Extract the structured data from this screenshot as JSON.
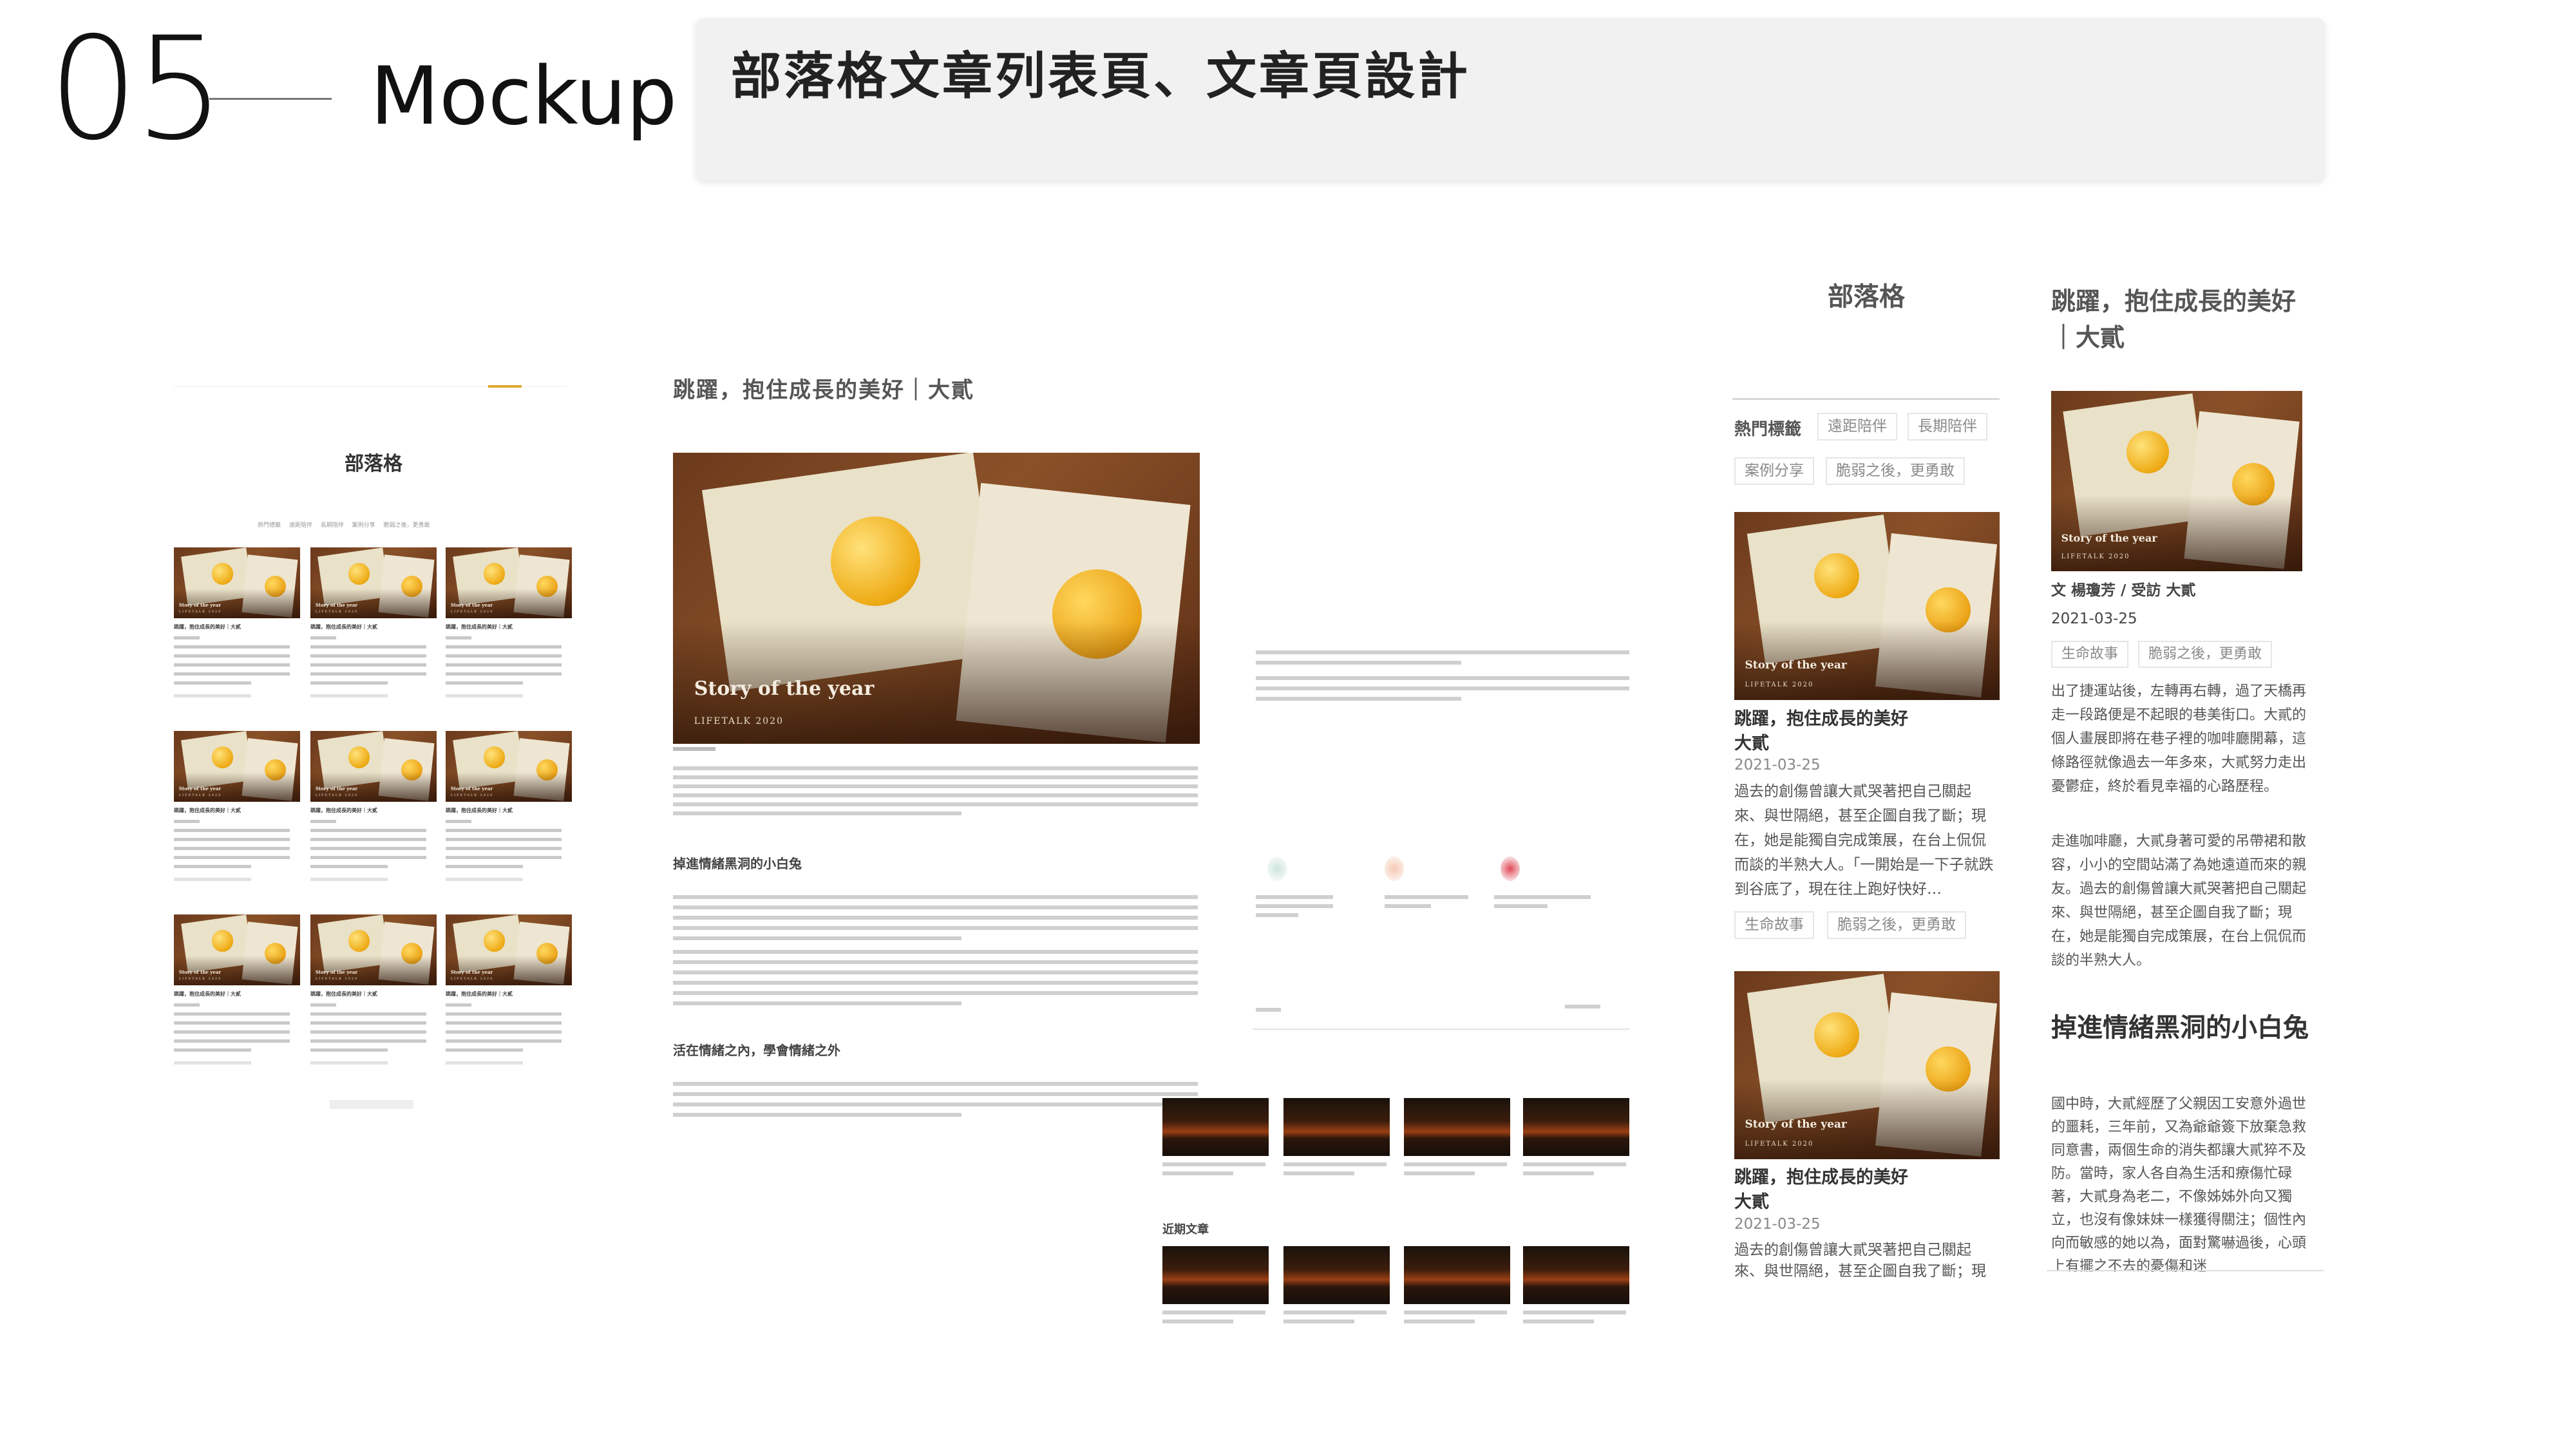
{
  "header": {
    "section_number": "05",
    "section_title": "Mockup",
    "caption": "部落格文章列表頁、文章頁設計"
  },
  "list_page": {
    "title": "部落格",
    "tags_row": "熱門標籤 遠距陪伴 長期陪伴 案例分享 脆弱之後，更勇敢",
    "card_title": "跳躍，抱住成長的美好｜大貳"
  },
  "article_page": {
    "title": "跳躍，抱住成長的美好｜大貳",
    "hero_caption": "Story of the year",
    "hero_sub": "LIFETALK 2020",
    "heading_1": "掉進情緒黑洞的小白兔",
    "heading_2": "活在情緒之內，學會情緒之外",
    "related_label": "近期文章"
  },
  "mobile_list": {
    "title": "部落格",
    "hot_label": "熱門標籤",
    "tags": [
      "遠距陪伴",
      "長期陪伴",
      "案例分享",
      "脆弱之後，更勇敢"
    ],
    "post": {
      "title": "跳躍，抱住成長的美好\n大貳",
      "date": "2021-03-25",
      "excerpt": "過去的創傷曾讓大貳哭著把自己關起來、與世隔絕，甚至企圖自我了斷；現在，她是能獨自完成策展，在台上侃侃而談的半熟大人。「一開始是一下子就跌到谷底了，現在往上跑好快好…",
      "excerpt_cut": "來、與世隔絕，甚至企圖自我了斷；現",
      "tags": [
        "生命故事",
        "脆弱之後，更勇敢"
      ]
    },
    "hero_caption": "Story of the year",
    "hero_sub": "LIFETALK 2020"
  },
  "mobile_article": {
    "title": "跳躍，抱住成長的美好｜大貳",
    "hero_caption": "Story of the year",
    "hero_sub": "LIFETALK 2020",
    "author": "文 楊瓊芳 / 受訪 大貳",
    "date": "2021-03-25",
    "tags": [
      "生命故事",
      "脆弱之後，更勇敢"
    ],
    "paragraph_1": "出了捷運站後，左轉再右轉，過了天橋再走一段路便是不起眼的巷美街口。大貳的個人畫展即將在巷子裡的咖啡廳開幕，這條路徑就像過去一年多來，大貳努力走出憂鬱症，終於看見幸福的心路歷程。",
    "paragraph_2": "走進咖啡廳，大貳身著可愛的吊帶裙和散容，小小的空間站滿了為她遠道而來的親友。過去的創傷曾讓大貳哭著把自己關起來、與世隔絕，甚至企圖自我了斷；現在，她是能獨自完成策展，在台上侃侃而談的半熟大人。",
    "heading": "掉進情緒黑洞的小白兔",
    "paragraph_3": "國中時，大貳經歷了父親因工安意外過世的噩耗，三年前，又為爺爺簽下放棄急救同意書，兩個生命的消失都讓大貳猝不及防。當時，家人各自為生活和療傷忙碌著，大貳身為老二，不像姊姊外向又獨立，也沒有像妹妹一樣獲得關注；個性內向而敏感的她以為，面對驚嚇過後，心頭上有擺之不去的憂傷和迷"
  },
  "colors": {
    "accent": "#e0a82e",
    "caption_box": "#f1f1f1",
    "wood": "#8a5128",
    "orange": "#eeaa14"
  }
}
